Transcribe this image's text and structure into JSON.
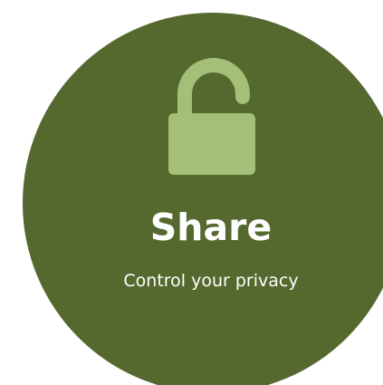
{
  "card": {
    "title": "Share",
    "subtitle": "Control your privacy",
    "icon": "unlocked-padlock-icon",
    "background_color": "#55692f",
    "icon_color": "#a4bf78",
    "text_color": "#ffffff"
  }
}
